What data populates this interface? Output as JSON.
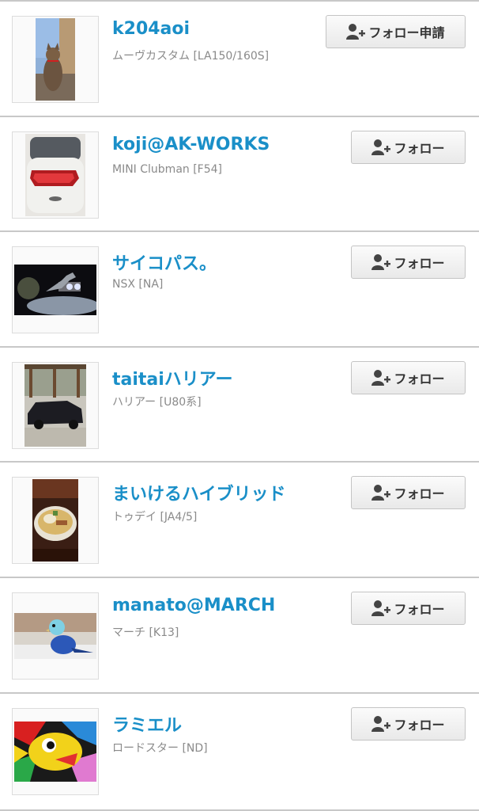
{
  "users": [
    {
      "name": "k204aoi",
      "car": "ムーヴカスタム [LA150/160S]",
      "button": "フォロー申請",
      "button_icon": "add-user-icon",
      "thumb": "cat-photo"
    },
    {
      "name": "koji@AK-WORKS",
      "car": "MINI Clubman [F54]",
      "button": "フォロー",
      "button_icon": "add-user-icon",
      "thumb": "car-taillight-photo"
    },
    {
      "name": "サイコパス。",
      "car": "NSX [NA]",
      "button": "フォロー",
      "button_icon": "add-user-icon",
      "thumb": "space-art-photo"
    },
    {
      "name": "taitaiハリアー",
      "car": "ハリアー [U80系]",
      "button": "フォロー",
      "button_icon": "add-user-icon",
      "thumb": "suv-photo"
    },
    {
      "name": "まいけるハイブリッド",
      "car": "トゥデイ [JA4/5]",
      "button": "フォロー",
      "button_icon": "add-user-icon",
      "thumb": "ramen-photo"
    },
    {
      "name": "manato@MARCH",
      "car": "マーチ [K13]",
      "button": "フォロー",
      "button_icon": "add-user-icon",
      "thumb": "parakeet-photo"
    },
    {
      "name": "ラミエル",
      "car": "ロードスター [ND]",
      "button": "フォロー",
      "button_icon": "add-user-icon",
      "thumb": "colorful-fish-art"
    }
  ],
  "colors": {
    "name": "#1a8fc8",
    "subtext": "#8a8a8a",
    "divider": "#c8c8c8"
  }
}
